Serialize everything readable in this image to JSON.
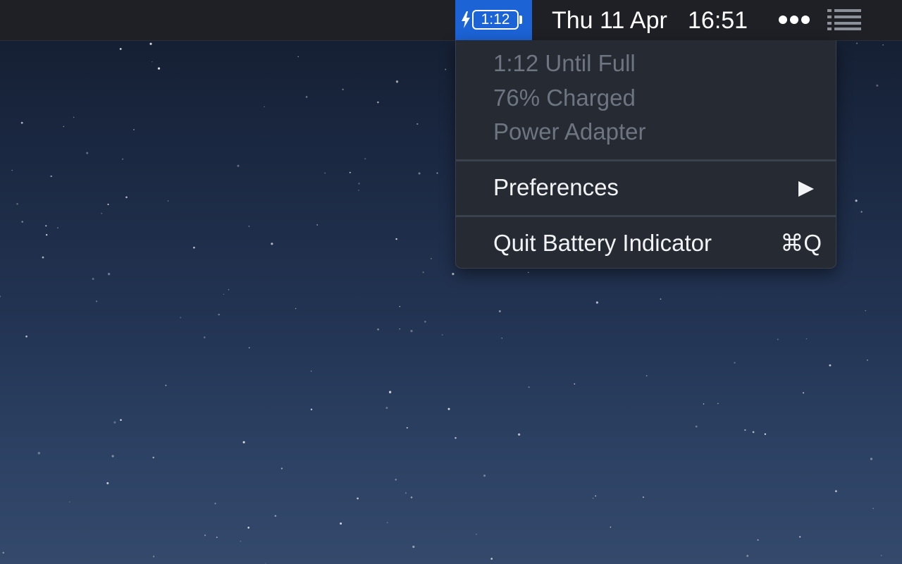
{
  "menubar": {
    "battery_time": "1:12",
    "date": "Thu 11 Apr",
    "time": "16:51",
    "icons": {
      "charging": "lightning-bolt-icon",
      "battery": "battery-icon",
      "more": "more-dots-icon",
      "notifications": "list-icon"
    },
    "accent_color": "#1c63d6"
  },
  "battery_menu": {
    "info": [
      "1:12 Until Full",
      "76% Charged",
      "Power Adapter"
    ],
    "preferences_label": "Preferences",
    "quit_label": "Quit Battery Indicator",
    "quit_shortcut": "⌘Q"
  }
}
